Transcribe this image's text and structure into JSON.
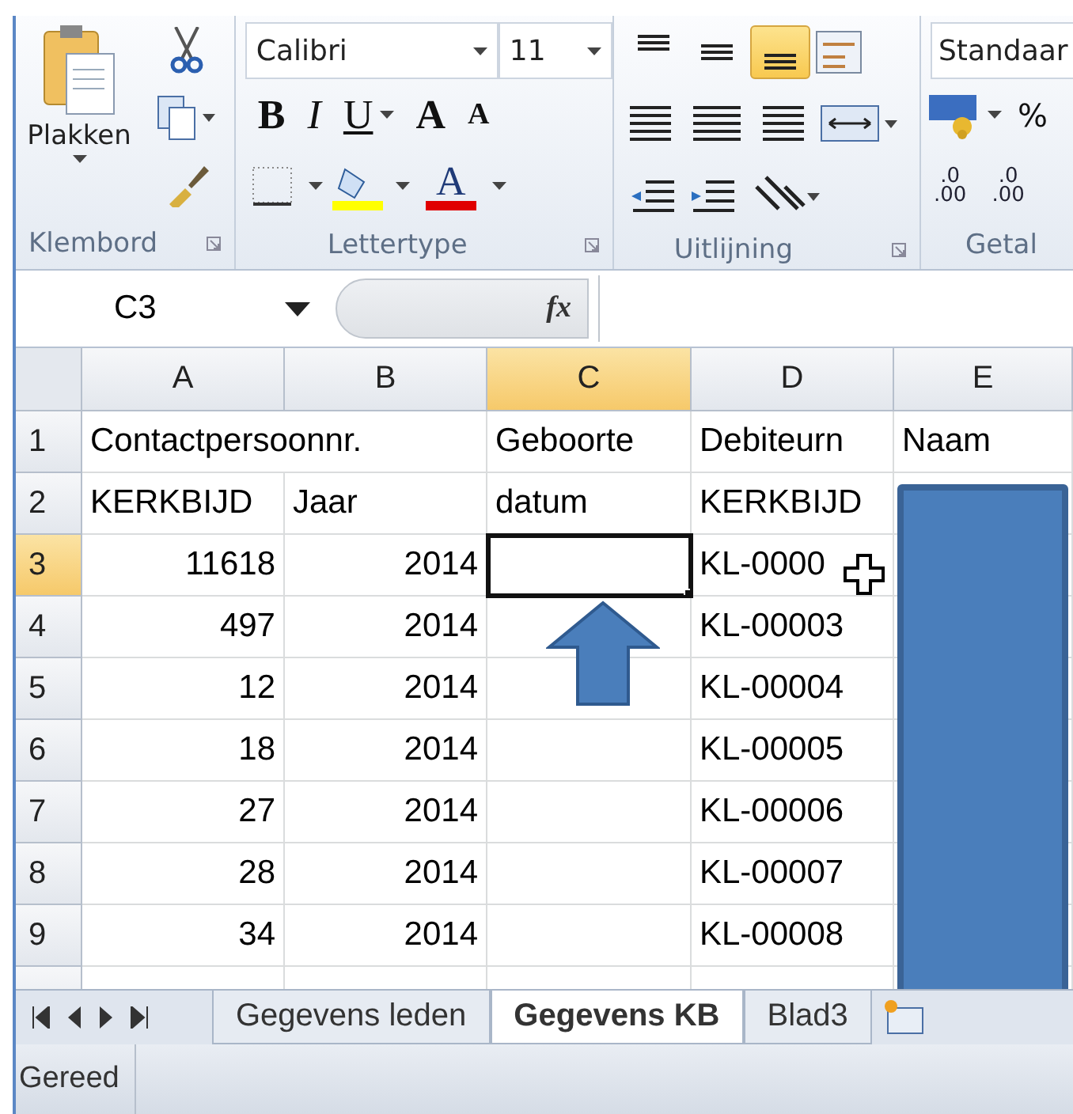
{
  "ribbon": {
    "clipboard": {
      "paste_label": "Plakken",
      "group": "Klembord"
    },
    "font": {
      "name": "Calibri",
      "size": "11",
      "bold": "B",
      "italic": "I",
      "underline": "U",
      "grow": "A",
      "shrink": "A",
      "font_color": "A",
      "group": "Lettertype"
    },
    "alignment": {
      "vertical": [
        {
          "kind": "top",
          "selected": false
        },
        {
          "kind": "middle",
          "selected": false
        },
        {
          "kind": "bottom",
          "selected": true
        }
      ],
      "group": "Uitlijning"
    },
    "number": {
      "format": "Standaar",
      "percent": "%",
      "decimals": [
        {
          "top": ".0",
          "bottom": ".00"
        },
        {
          "top": ".0",
          "bottom": ".00"
        }
      ],
      "group": "Getal"
    }
  },
  "formula_bar": {
    "name_box": "C3",
    "fx": "fx"
  },
  "sheet": {
    "columns": [
      {
        "label": "A",
        "selected": false,
        "kind": "number"
      },
      {
        "label": "B",
        "selected": false,
        "kind": "number"
      },
      {
        "label": "C",
        "selected": true,
        "kind": "text"
      },
      {
        "label": "D",
        "selected": false,
        "kind": "text"
      },
      {
        "label": "E",
        "selected": false,
        "kind": "text"
      }
    ],
    "rows": [
      {
        "number": "1",
        "selected": false,
        "kind": "header",
        "cells": [
          "Contactpersoonnr.",
          "",
          "Geboorte",
          "Debiteurn",
          "Naam"
        ]
      },
      {
        "number": "2",
        "selected": false,
        "kind": "header",
        "cells": [
          "KERKBIJD",
          "Jaar",
          "datum",
          "KERKBIJD"
        ]
      },
      {
        "number": "3",
        "selected": true,
        "kind": "data",
        "cells": [
          "11618",
          "2014",
          "",
          "KL-0000"
        ]
      },
      {
        "number": "4",
        "selected": false,
        "kind": "data",
        "cells": [
          "497",
          "2014",
          "",
          "KL-00003"
        ]
      },
      {
        "number": "5",
        "selected": false,
        "kind": "data",
        "cells": [
          "12",
          "2014",
          "",
          "KL-00004"
        ]
      },
      {
        "number": "6",
        "selected": false,
        "kind": "data",
        "cells": [
          "18",
          "2014",
          "",
          "KL-00005"
        ]
      },
      {
        "number": "7",
        "selected": false,
        "kind": "data",
        "cells": [
          "27",
          "2014",
          "",
          "KL-00006"
        ]
      },
      {
        "number": "8",
        "selected": false,
        "kind": "data",
        "cells": [
          "28",
          "2014",
          "",
          "KL-00007"
        ]
      },
      {
        "number": "9",
        "selected": false,
        "kind": "data",
        "cells": [
          "34",
          "2014",
          "",
          "KL-00008"
        ]
      }
    ]
  },
  "sheet_tabs": [
    {
      "label": "Gegevens leden",
      "selected": false
    },
    {
      "label": "Gegevens KB",
      "selected": true
    },
    {
      "label": "Blad3",
      "selected": false
    }
  ],
  "status_bar": {
    "text": "Gereed"
  }
}
